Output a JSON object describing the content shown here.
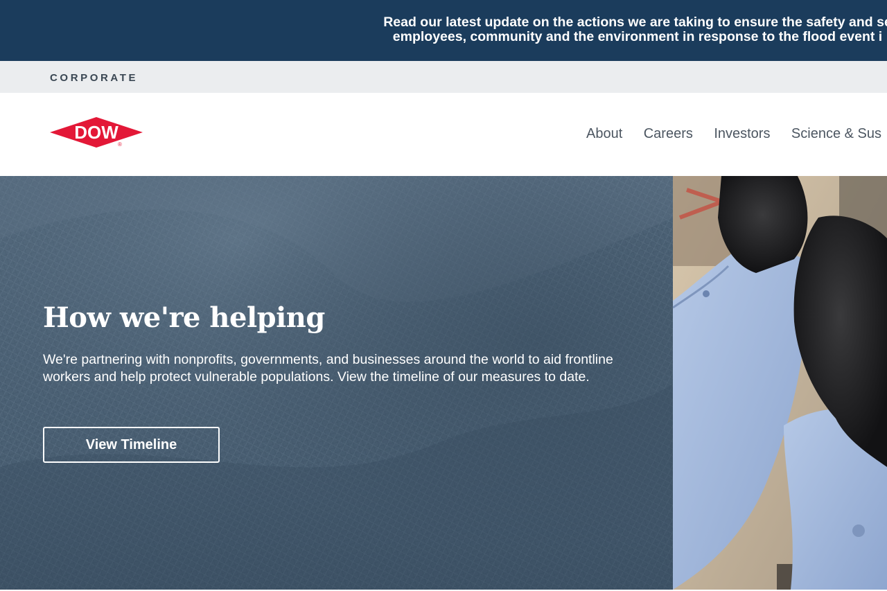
{
  "alert": {
    "line1": "Read our latest update on the actions we are taking to ensure the safety and se",
    "line2": "employees, community and the environment in response to the flood event i"
  },
  "site": {
    "section": "CORPORATE"
  },
  "logo": {
    "text": "DOW",
    "registered": "®",
    "color": "#e31837"
  },
  "nav": {
    "items": [
      {
        "label": "About"
      },
      {
        "label": "Careers"
      },
      {
        "label": "Investors"
      },
      {
        "label": "Science & Sus"
      }
    ]
  },
  "hero": {
    "title": "How we're helping",
    "body": "We're partnering with nonprofits, governments, and businesses around the world to aid frontline workers and help protect vulnerable populations. View the timeline of our measures to date.",
    "cta_label": "View Timeline"
  },
  "colors": {
    "alert_bg": "#1b3c5c",
    "corp_bar_bg": "#ebedef",
    "hero_bg": "#4c6276"
  }
}
